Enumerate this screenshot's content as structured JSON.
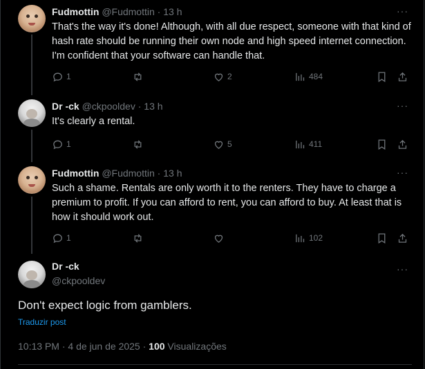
{
  "posts": [
    {
      "name": "Fudmottin",
      "handle": "@Fudmottin",
      "time": "13 h",
      "text": "That's the way it's done! Although, with all due respect, someone with that kind of hash rate should be running their own node and high speed internet connection. I'm confident that your software can handle that.",
      "replies": "1",
      "reposts": "",
      "likes": "2",
      "views": "484"
    },
    {
      "name": "Dr -ck",
      "handle": "@ckpooldev",
      "time": "13 h",
      "text": "It's clearly a rental.",
      "replies": "1",
      "reposts": "",
      "likes": "5",
      "views": "411"
    },
    {
      "name": "Fudmottin",
      "handle": "@Fudmottin",
      "time": "13 h",
      "text": "Such a shame. Rentals are only worth it to the renters. They have to charge a premium to profit. If you can afford to rent, you can afford to buy. At least that is how it should work out.",
      "replies": "1",
      "reposts": "",
      "likes": "",
      "views": "102"
    }
  ],
  "main_post": {
    "name": "Dr -ck",
    "handle": "@ckpooldev",
    "text": "Don't expect logic from gamblers.",
    "translate_label": "Traduzir post",
    "time": "10:13 PM",
    "date": "4 de jun de 2025",
    "views_count": "100",
    "views_label": "Visualizações"
  },
  "more_glyph": "···",
  "separator": "·",
  "icons": [
    "reply-icon",
    "repost-icon",
    "like-icon",
    "views-icon",
    "bookmark-icon",
    "share-icon",
    "more-icon"
  ],
  "colors": {
    "background": "#000000",
    "text": "#e7e9ea",
    "muted": "#71767b",
    "link": "#1d9bf0"
  }
}
